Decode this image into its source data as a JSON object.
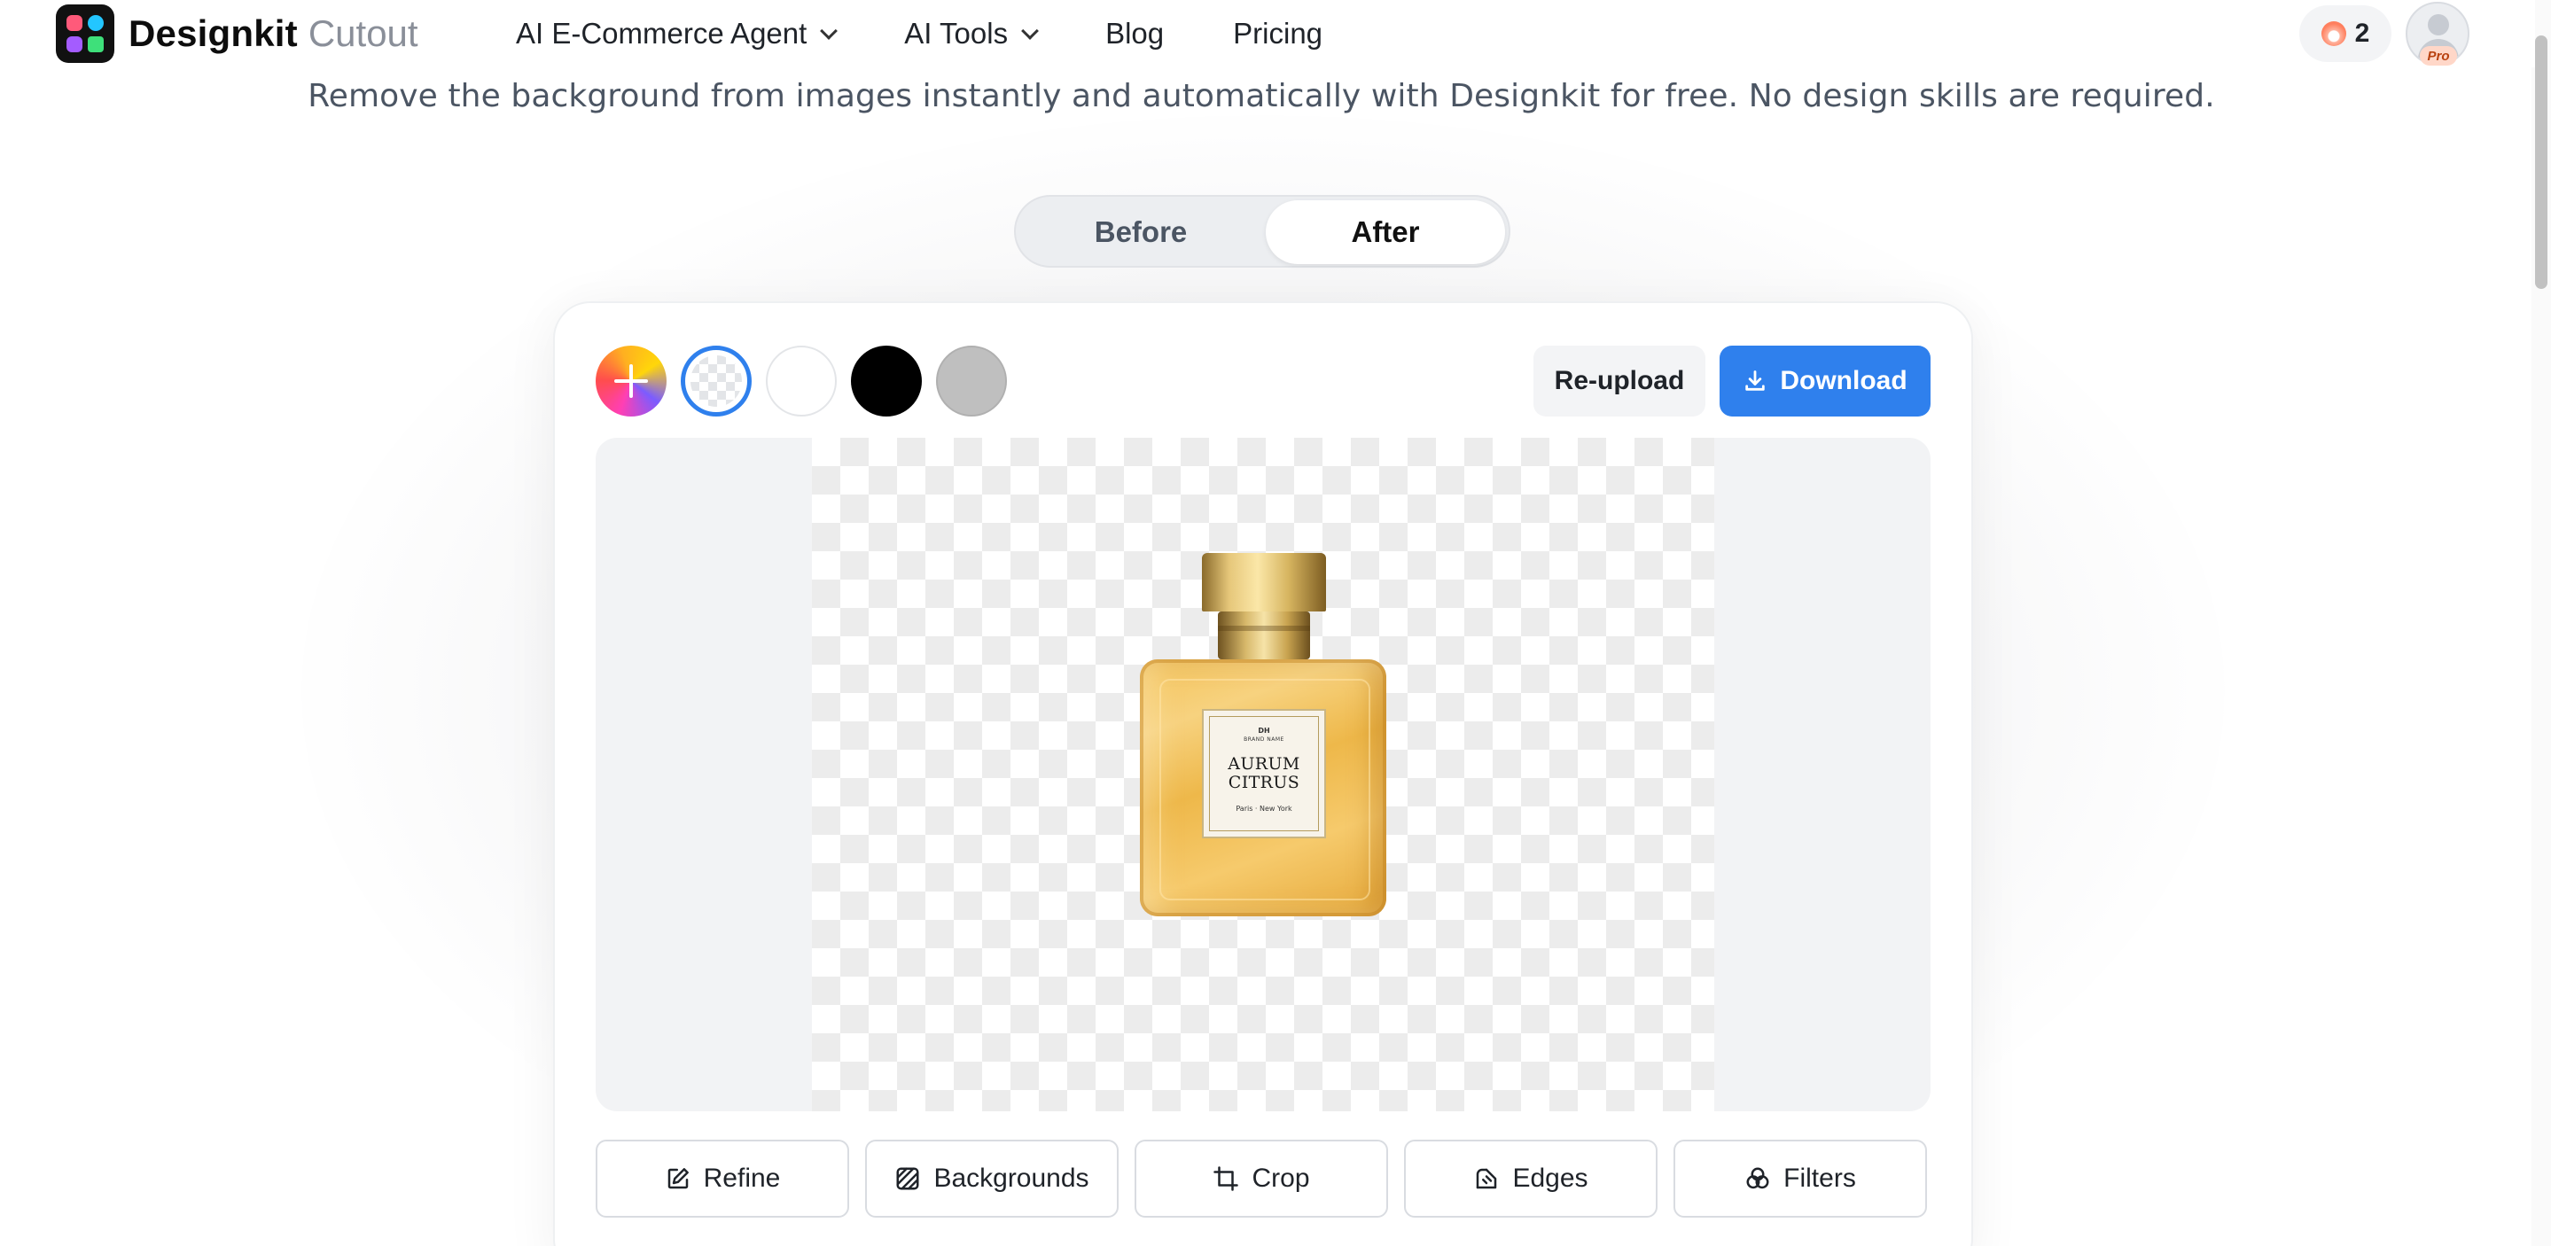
{
  "header": {
    "brand": "Designkit",
    "product": "Cutout",
    "nav": [
      {
        "label": "AI E-Commerce Agent",
        "dropdown": true
      },
      {
        "label": "AI Tools",
        "dropdown": true
      },
      {
        "label": "Blog",
        "dropdown": false
      },
      {
        "label": "Pricing",
        "dropdown": false
      }
    ],
    "credits": "2",
    "pro_badge": "Pro"
  },
  "hero": {
    "subtitle": "Remove the background from images instantly and automatically with Designkit for free. No design skills are required."
  },
  "toggle": {
    "before_label": "Before",
    "after_label": "After",
    "active": "After"
  },
  "editor": {
    "swatches": [
      {
        "name": "add-color",
        "color": "gradient"
      },
      {
        "name": "transparent",
        "color": "transparent",
        "selected": true
      },
      {
        "name": "white",
        "color": "#ffffff"
      },
      {
        "name": "black",
        "color": "#000000"
      },
      {
        "name": "gray",
        "color": "#bfbfbf"
      }
    ],
    "reupload_label": "Re-upload",
    "download_label": "Download",
    "accent_color": "#2f80ed",
    "product_label": {
      "mono": "DH",
      "brand_name": "BRAND NAME",
      "name_line1": "AURUM",
      "name_line2": "CITRUS",
      "location": "Paris · New York"
    },
    "tools": [
      {
        "label": "Refine",
        "icon": "edit-icon"
      },
      {
        "label": "Backgrounds",
        "icon": "hatch-icon"
      },
      {
        "label": "Crop",
        "icon": "crop-icon"
      },
      {
        "label": "Edges",
        "icon": "edges-icon"
      },
      {
        "label": "Filters",
        "icon": "filters-icon"
      }
    ]
  }
}
